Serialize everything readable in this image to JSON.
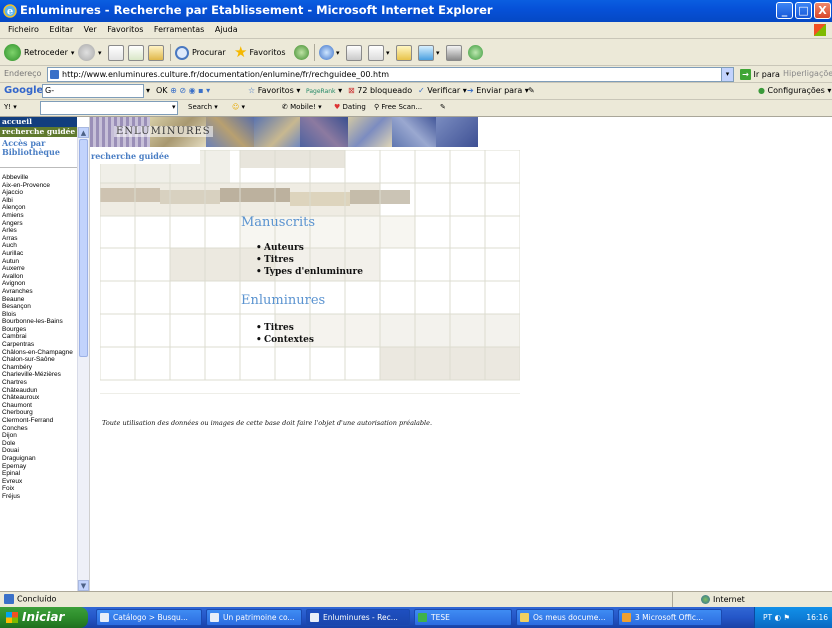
{
  "window": {
    "title": "Enluminures - Recherche par Etablissement - Microsoft Internet Explorer",
    "buttons": {
      "minimize": "_",
      "maximize": "□",
      "close": "X"
    }
  },
  "menubar": {
    "items": [
      "Ficheiro",
      "Editar",
      "Ver",
      "Favoritos",
      "Ferramentas",
      "Ajuda"
    ]
  },
  "toolbar": {
    "back": "Retroceder",
    "search": "Procurar",
    "favorites": "Favoritos"
  },
  "addressbar": {
    "label": "Endereço",
    "url": "http://www.enluminures.culture.fr/documentation/enlumine/fr/rechguidee_00.htm",
    "go": "Ir para",
    "links": "Hiperligações"
  },
  "googlebar": {
    "logo": "Google",
    "field": "G-",
    "ok": "OK",
    "favorites": "Favoritos",
    "pagerank": "PageRank",
    "blocked": "72 bloqueado",
    "verify": "Verificar",
    "send": "Enviar para",
    "settings": "Configurações"
  },
  "searchbar": {
    "search": "Search",
    "mobile": "Mobile!",
    "dating": "Dating",
    "freescan": "Free Scan..."
  },
  "sidebar": {
    "accueil": "accueil",
    "recherche": "recherche guidée",
    "acces": "Accès par Bibliothèque",
    "cities": [
      "Abbeville",
      "Aix-en-Provence",
      "Ajaccio",
      "Albi",
      "Alençon",
      "Amiens",
      "Angers",
      "Arles",
      "Arras",
      "Auch",
      "Aurillac",
      "Autun",
      "Auxerre",
      "Avallon",
      "Avignon",
      "Avranches",
      "Beaune",
      "Besançon",
      "Blois",
      "Bourbonne-les-Bains",
      "Bourges",
      "Cambrai",
      "Carpentras",
      "Châlons-en-Champagne",
      "Chalon-sur-Saône",
      "Chambéry",
      "Charleville-Mézières",
      "Chartres",
      "Châteaudun",
      "Châteauroux",
      "Chaumont",
      "Cherbourg",
      "Clermont-Ferrand",
      "Conches",
      "Dijon",
      "Dole",
      "Douai",
      "Draguignan",
      "Epernay",
      "Epinal",
      "Evreux",
      "Foix",
      "Fréjus"
    ]
  },
  "main": {
    "banner_word": "ENLUMINURES",
    "page_title": "recherche guidée",
    "manuscrits": {
      "title": "Manuscrits",
      "links": [
        "Auteurs",
        "Titres",
        "Types d'enluminure"
      ]
    },
    "enluminures": {
      "title": "Enluminures",
      "links": [
        "Titres",
        "Contextes"
      ]
    },
    "legal": "Toute utilisation des données ou images de cette base doit faire l'objet d'une autorisation préalable."
  },
  "statusbar": {
    "status": "Concluído",
    "zone": "Internet"
  },
  "taskbar": {
    "start": "Iniciar",
    "tasks": [
      "Catálogo > Busqu...",
      "Un patrimoine co...",
      "Enluminures - Rec...",
      "TESE",
      "Os meus docume...",
      "3 Microsoft Offic..."
    ],
    "lang": "PT",
    "clock": "16:16"
  },
  "colors": {
    "titlebar": "#0651d8",
    "accent_blue": "#5a93d0",
    "sidebar_nav": "#123e7e",
    "sidebar_active": "#5f7a2e"
  }
}
